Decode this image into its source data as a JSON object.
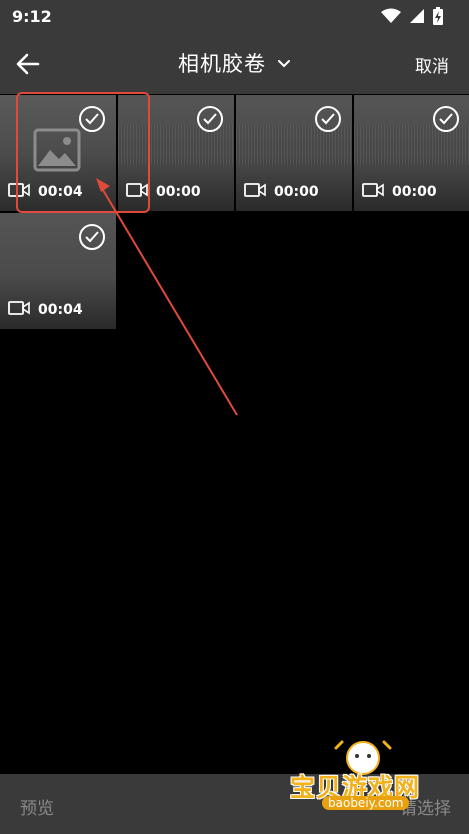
{
  "status_bar": {
    "time": "9:12"
  },
  "top_bar": {
    "title": "相机胶卷",
    "cancel_label": "取消"
  },
  "grid": {
    "items": [
      {
        "duration": "00:04",
        "has_placeholder": true
      },
      {
        "duration": "00:00"
      },
      {
        "duration": "00:00"
      },
      {
        "duration": "00:00"
      },
      {
        "duration": "00:04"
      }
    ]
  },
  "bottom_bar": {
    "preview_label": "预览",
    "select_label": "请选择"
  },
  "watermark": {
    "brand": "宝贝游戏网",
    "url": "baobeiy.com"
  },
  "colors": {
    "bar_bg": "#3a3a3a",
    "annotation": "#e04a3a",
    "disabled_text": "#8a8a8a",
    "watermark": "#f3b21a"
  }
}
